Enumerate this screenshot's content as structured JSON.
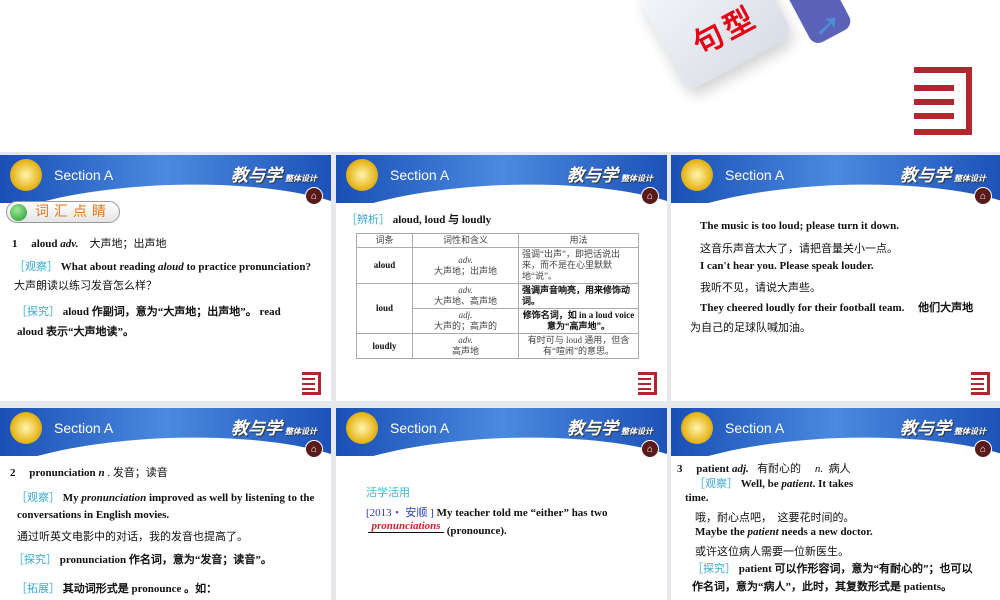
{
  "top": {
    "tile_text": "句型",
    "arrow_icon": "arrow-icon"
  },
  "header": {
    "section": "Section A",
    "logo": "教与学",
    "logo_sub": "整体设计"
  },
  "s1": {
    "pill": "词汇点睛",
    "l1_num": "1",
    "l1_word": "aloud",
    "l1_pos": "adv.",
    "l1_mean": "大声地；出声地",
    "tag_obs": "［观察］",
    "obs1": "What about reading",
    "obs_it": "aloud",
    "obs2": "to practice pronunciation?",
    "obs_cn": "大声朗读以练习发音怎么样？",
    "tag_exp": "［探究］",
    "exp1": "aloud 作副词，意为“大声地；出声地”。 read",
    "exp2": "aloud 表示“大声地读”。"
  },
  "s2": {
    "tag": "［辨析］",
    "title": "aloud, loud 与 loudly",
    "headers": [
      "词条",
      "词性和含义",
      "用法"
    ],
    "rows": [
      {
        "w": "aloud",
        "pos": "adv.",
        "m": "大声地；出声地",
        "u": "强调“出声”，即把话说出来，而不是在心里默默地“说”。"
      },
      {
        "w": "loud",
        "pos": "adv.",
        "m": "大声地、高声地",
        "u": "强调声音响亮，用来修饰动词。"
      },
      {
        "pos": "adj.",
        "m": "大声的；高声的",
        "u": "修饰名词，如 in a loud voice 意为“高声地”。"
      },
      {
        "w": "loudly",
        "pos": "adv.",
        "m": "高声地",
        "u": "有时可与 loud 通用，但含有“喧闹”的意思。"
      }
    ]
  },
  "s3": {
    "lines": [
      "The music is too loud; please turn it down.",
      "这音乐声音太大了，请把音量关小一点。",
      "I can't hear you. Please speak louder.",
      "我听不见，请说大声些。",
      "They cheered loudly for their football team.　 他们大声地",
      "为自己的足球队喊加油。"
    ]
  },
  "s4": {
    "num": "2",
    "word": "pronunciation",
    "pos": "n",
    "mean": ". 发音；读音",
    "tag_obs": "［观察］",
    "obs1": "My",
    "obs_it": "pronunciation",
    "obs2": "improved as well by listening to the",
    "obs3": "conversations in English movies.",
    "obs_cn": "通过听英文电影中的对话，我的发音也提高了。",
    "tag_exp": "［探究］",
    "exp": "pronunciation 作名词，意为“发音；读音”。",
    "tag_ext": "［拓展］",
    "ext": "其动词形式是 pronounce 。如："
  },
  "s5": {
    "label": "活学活用",
    "src": "[2013・ 安顺 ]",
    "q": "My teacher told me “either” has two",
    "answer": "pronunciations",
    "hint": "(pronounce)."
  },
  "s6": {
    "num": "3",
    "word": "patient",
    "pos": "adj.",
    "m1": "有耐心的",
    "pos2": "n.",
    "m2": "病人",
    "tag_obs": "［观察］",
    "obs1": "Well, be",
    "obs_it": "patient",
    "obs2": ". It takes",
    "obs3": "time.",
    "obs_cn": "哦，耐心点吧，　这要花时间的。",
    "ex1a": "Maybe the",
    "ex1_it": "patient",
    "ex1b": "needs a new doctor.",
    "ex_cn": "或许这位病人需要一位新医生。",
    "tag_exp": "［探究］",
    "exp1": "patient 可以作形容词，意为“有耐心的”；也可以",
    "exp2": "作名词，意为“病人”，此时，其复数形式是 patients。"
  }
}
